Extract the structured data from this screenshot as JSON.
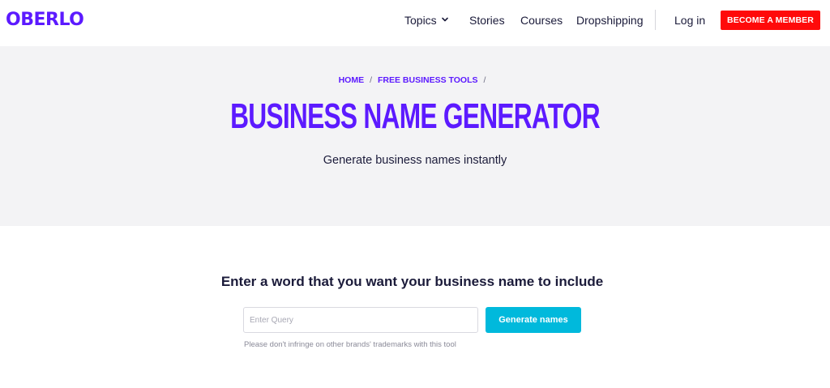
{
  "header": {
    "logo": "OBERLO",
    "nav": {
      "topics": "Topics",
      "stories": "Stories",
      "courses": "Courses",
      "dropshipping": "Dropshipping",
      "login": "Log in"
    },
    "member_button": "BECOME A MEMBER"
  },
  "hero": {
    "breadcrumb": [
      "HOME",
      "FREE BUSINESS TOOLS"
    ],
    "separator": "/",
    "title": "BUSINESS NAME GENERATOR",
    "subtitle": "Generate business names instantly"
  },
  "tool": {
    "prompt": "Enter a word that you want your business name to include",
    "input_placeholder": "Enter Query",
    "input_value": "",
    "button_label": "Generate names",
    "disclaimer": "Please don't infringe on other brands' trademarks with this tool"
  },
  "colors": {
    "brand": "#5c1aff",
    "member_button": "#ff0a0a",
    "generate_button": "#00b9dc",
    "hero_bg": "#f3f3f5"
  },
  "icons": {
    "topics_dropdown": "chevron-down-icon"
  }
}
